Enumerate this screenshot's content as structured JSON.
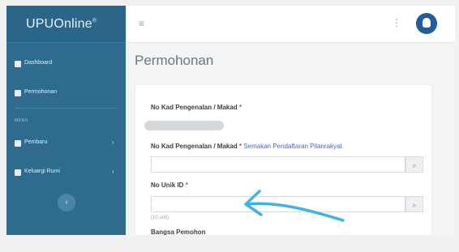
{
  "sidebar": {
    "brand": "UPUOnline",
    "brand_mark": "®",
    "section": "MENU",
    "items": [
      {
        "label": "Dashboard",
        "icon": "home-icon"
      },
      {
        "label": "Permohonan",
        "icon": "document-icon"
      },
      {
        "label": "Pembaru",
        "icon": "folder-icon"
      },
      {
        "label": "Keluargi Rumi",
        "icon": "users-icon"
      }
    ],
    "toggle": "‹"
  },
  "topbar": {
    "menu_icon": "≡",
    "more_icon": "⋮"
  },
  "page": {
    "title": "Permohonan"
  },
  "form": {
    "field1_label": "No Kad Pengenalan / Makad",
    "field2_label": "No Kad Pengenalan / Makad",
    "field2_link": "Semakan Pendaftaran Pilanrakyat",
    "field3_label": "No Unik ID",
    "required": "*",
    "hint": "(10 unit)",
    "next_label": "Bangsa Pemohon",
    "search_icon": "⌕"
  },
  "colors": {
    "sidebar": "#2e6b8f",
    "accent": "#1f5e9a",
    "annotation": "#3fb4e0"
  }
}
